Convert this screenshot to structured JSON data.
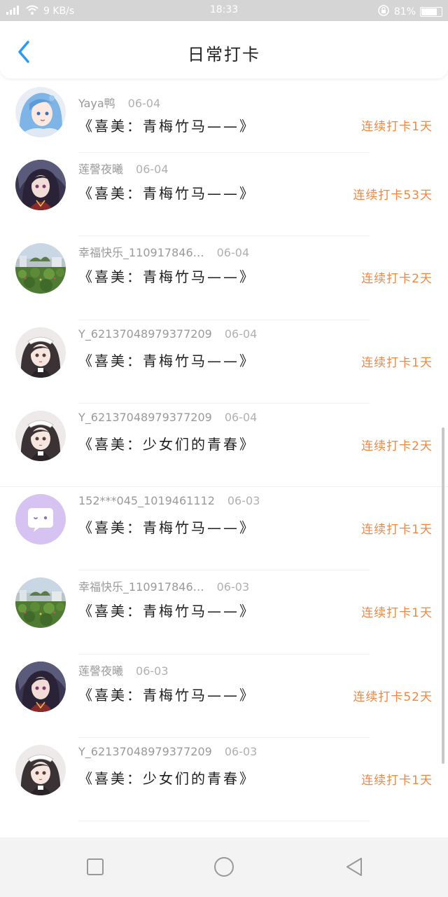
{
  "status_bar": {
    "network_speed": "9 KB/s",
    "time": "18:33",
    "battery_percent": "81%",
    "battery_level": 0.81
  },
  "header": {
    "title": "日常打卡"
  },
  "entries": [
    {
      "name": "Yaya鸭",
      "date": "06-04",
      "book": "《喜美：青梅竹马——》",
      "streak": "连续打卡1天",
      "avatar": "anime-blue-hair"
    },
    {
      "name": "莲謦夜曦",
      "date": "06-04",
      "book": "《喜美：青梅竹马——》",
      "streak": "连续打卡53天",
      "avatar": "anime-dark-hair"
    },
    {
      "name": "幸福快乐_110917846…",
      "date": "06-04",
      "book": "《喜美：青梅竹马——》",
      "streak": "连续打卡2天",
      "avatar": "garden-photo"
    },
    {
      "name": "Y_62137048979377209",
      "date": "06-04",
      "book": "《喜美：青梅竹马——》",
      "streak": "连续打卡1天",
      "avatar": "anime-maid"
    },
    {
      "name": "Y_62137048979377209",
      "date": "06-04",
      "book": "《喜美：少女们的青春》",
      "streak": "连续打卡2天",
      "avatar": "anime-maid"
    },
    {
      "name": "152***045_1019461112",
      "date": "06-03",
      "book": "《喜美：青梅竹马——》",
      "streak": "连续打卡1天",
      "avatar": "purple-chat-bubble"
    },
    {
      "name": "幸福快乐_110917846…",
      "date": "06-03",
      "book": "《喜美：青梅竹马——》",
      "streak": "连续打卡1天",
      "avatar": "garden-photo"
    },
    {
      "name": "莲謦夜曦",
      "date": "06-03",
      "book": "《喜美：青梅竹马——》",
      "streak": "连续打卡52天",
      "avatar": "anime-dark-hair"
    },
    {
      "name": "Y_62137048979377209",
      "date": "06-03",
      "book": "《喜美：少女们的青春》",
      "streak": "连续打卡1天",
      "avatar": "anime-maid"
    }
  ],
  "colors": {
    "accent_blue": "#2b9af3",
    "streak_orange": "#ee8844",
    "status_bar_bg": "#d5d5d5",
    "nav_bar_bg": "#f3f3f3"
  },
  "nav_bar": {
    "recent_icon": "square-icon",
    "home_icon": "circle-icon",
    "back_icon": "triangle-back-icon"
  }
}
